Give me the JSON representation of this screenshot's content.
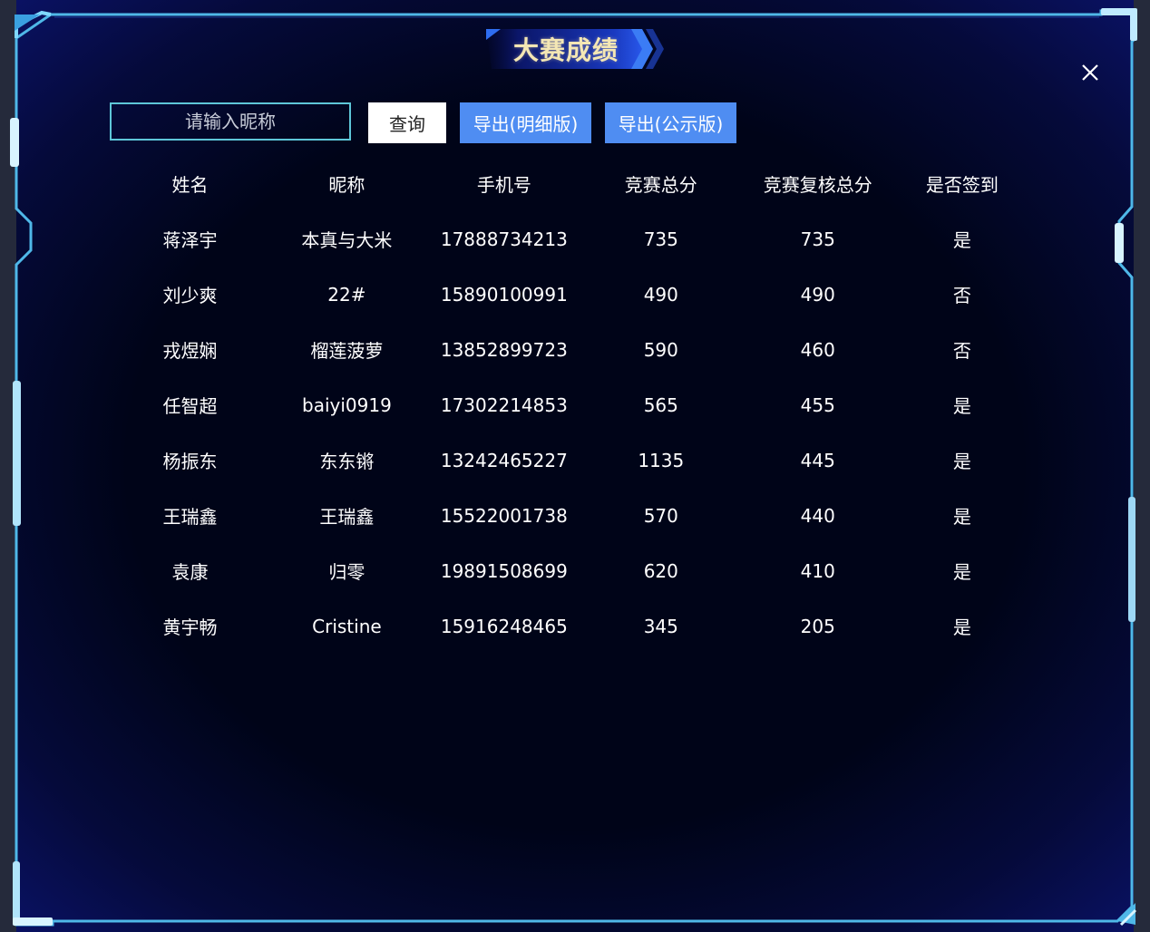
{
  "dialog": {
    "title": "大赛成绩"
  },
  "toolbar": {
    "search_placeholder": "请输入昵称",
    "query_label": "查询",
    "export_detail_label": "导出(明细版)",
    "export_public_label": "导出(公示版)"
  },
  "table": {
    "headers": [
      "姓名",
      "昵称",
      "手机号",
      "竞赛总分",
      "竞赛复核总分",
      "是否签到"
    ],
    "rows": [
      [
        "蒋泽宇",
        "本真与大米",
        "17888734213",
        "735",
        "735",
        "是"
      ],
      [
        "刘少爽",
        "22#",
        "15890100991",
        "490",
        "490",
        "否"
      ],
      [
        "戎煜娴",
        "榴莲菠萝",
        "13852899723",
        "590",
        "460",
        "否"
      ],
      [
        "任智超",
        "baiyi0919",
        "17302214853",
        "565",
        "455",
        "是"
      ],
      [
        "杨振东",
        "东东锵",
        "13242465227",
        "1135",
        "445",
        "是"
      ],
      [
        "王瑞鑫",
        "王瑞鑫",
        "15522001738",
        "570",
        "440",
        "是"
      ],
      [
        "袁康",
        "归零",
        "19891508699",
        "620",
        "410",
        "是"
      ],
      [
        "黄宇畅",
        "Cristine",
        "15916248465",
        "345",
        "205",
        "是"
      ]
    ]
  },
  "colors": {
    "frame": "#4fb8e8",
    "accent_button": "#4f8df2",
    "title_text": "#f4e7b4",
    "background": "#000418"
  },
  "icons": {
    "close": "close-icon"
  }
}
